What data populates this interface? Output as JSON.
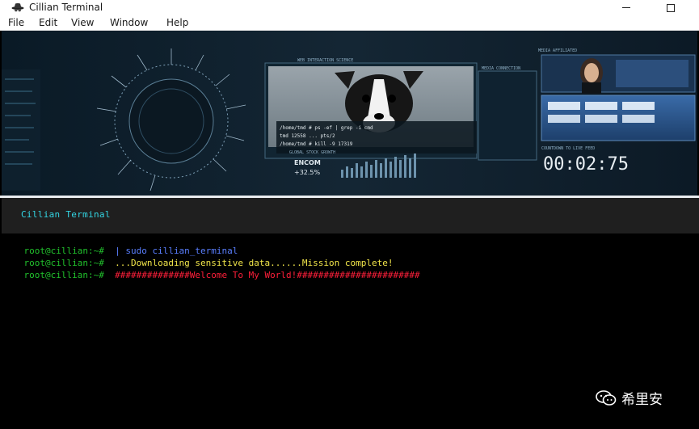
{
  "window": {
    "title": "Cillian Terminal"
  },
  "menu": {
    "items": [
      "File",
      "Edit",
      "View",
      "Window",
      "Help"
    ]
  },
  "banner": {
    "labels": {
      "interaction": "WEB INTERACTION SCIENCE",
      "media": "MEDIA AFFILIATED",
      "stock": "GLOBAL STOCK GROWTH",
      "encom": "ENCOM",
      "encom_pct": "+32.5%",
      "countdown_label": "COUNTDOWN TO LIVE FEED",
      "countdown": "00:02:75",
      "media_connect": "MEDIA CONNECTION",
      "cmd1": "/home/tmd # ps -ef | grep -i cmd",
      "cmd2": "tmd      12558 ... pts/2",
      "cmd3": "/home/tmd # kill -9 17319"
    }
  },
  "header": {
    "title": "Cillian Terminal"
  },
  "terminal": {
    "lines": [
      {
        "prompt": "root@cillian:~# ",
        "text": " | sudo cillian_terminal"
      },
      {
        "prompt": "root@cillian:~# ",
        "text": " ...Downloading sensitive data......Mission complete!"
      },
      {
        "prompt": "root@cillian:~# ",
        "text": " ##############Welcome To My World!#######################"
      }
    ]
  },
  "watermark": {
    "text": "希里安"
  },
  "colors": {
    "prompt": "#21c12c",
    "cmd": "#5a7fff",
    "warn": "#f2e64a",
    "hot": "#ff1f3a",
    "header_text": "#33d6e4"
  }
}
